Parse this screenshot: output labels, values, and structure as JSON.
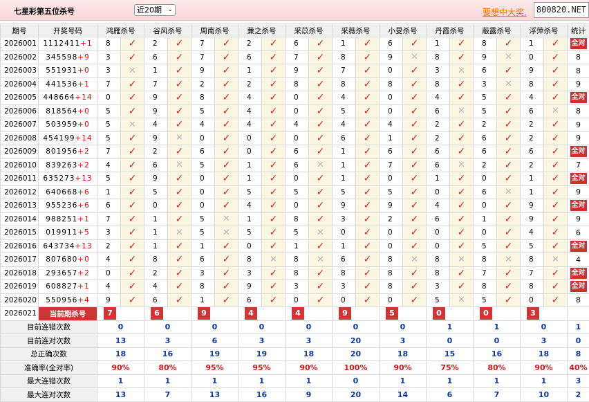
{
  "header": {
    "title": "七星彩第五位杀号",
    "period_select": "近20期",
    "slogan": "要想中大奖,",
    "logo": "800820.NET"
  },
  "columns": {
    "issue": "期号",
    "draw": "开奖号码",
    "experts": [
      "鸿雁杀号",
      "谷风杀号",
      "周南杀号",
      "蒹之杀号",
      "采苡杀号",
      "采薇杀号",
      "小旻杀号",
      "丹霞杀号",
      "蔽露杀号",
      "浮萍杀号"
    ],
    "stat": "统计"
  },
  "rows": [
    {
      "issue": "2026001",
      "nums": "1112411",
      "add": "+1",
      "kills": [
        8,
        2,
        7,
        2,
        6,
        1,
        6,
        1,
        8,
        1
      ],
      "hits": [
        1,
        1,
        1,
        1,
        1,
        1,
        1,
        1,
        1,
        1
      ],
      "stat": "全对"
    },
    {
      "issue": "2026002",
      "nums": "345598",
      "add": "+9",
      "kills": [
        3,
        6,
        7,
        6,
        7,
        8,
        9,
        8,
        9,
        0
      ],
      "hits": [
        1,
        1,
        1,
        1,
        1,
        1,
        0,
        1,
        0,
        1
      ],
      "stat": "8"
    },
    {
      "issue": "2026003",
      "nums": "551931",
      "add": "+0",
      "kills": [
        3,
        1,
        9,
        1,
        9,
        7,
        0,
        3,
        6,
        9
      ],
      "hits": [
        0,
        1,
        1,
        1,
        1,
        1,
        1,
        0,
        1,
        1
      ],
      "stat": "8"
    },
    {
      "issue": "2026004",
      "nums": "441536",
      "add": "+1",
      "kills": [
        7,
        7,
        2,
        2,
        8,
        8,
        8,
        8,
        3,
        8
      ],
      "hits": [
        1,
        1,
        1,
        1,
        1,
        1,
        1,
        1,
        0,
        1
      ],
      "stat": "9"
    },
    {
      "issue": "2026005",
      "nums": "448664",
      "add": "+14",
      "kills": [
        0,
        9,
        8,
        4,
        0,
        4,
        0,
        4,
        5,
        4
      ],
      "hits": [
        1,
        1,
        1,
        1,
        1,
        1,
        1,
        1,
        1,
        1
      ],
      "stat": "全对"
    },
    {
      "issue": "2026006",
      "nums": "818564",
      "add": "+0",
      "kills": [
        5,
        9,
        5,
        4,
        0,
        5,
        0,
        6,
        5,
        6
      ],
      "hits": [
        1,
        1,
        1,
        1,
        1,
        1,
        1,
        0,
        1,
        0
      ],
      "stat": "8"
    },
    {
      "issue": "2026007",
      "nums": "503959",
      "add": "+0",
      "kills": [
        5,
        4,
        4,
        4,
        4,
        4,
        4,
        2,
        2,
        2
      ],
      "hits": [
        0,
        1,
        1,
        1,
        1,
        1,
        1,
        1,
        1,
        1
      ],
      "stat": "9"
    },
    {
      "issue": "2026008",
      "nums": "454199",
      "add": "+14",
      "kills": [
        5,
        9,
        0,
        0,
        0,
        6,
        1,
        2,
        6,
        2
      ],
      "hits": [
        1,
        0,
        1,
        1,
        1,
        1,
        1,
        1,
        1,
        1
      ],
      "stat": "9"
    },
    {
      "issue": "2026009",
      "nums": "801956",
      "add": "+2",
      "kills": [
        7,
        2,
        6,
        0,
        6,
        1,
        6,
        6,
        6,
        6
      ],
      "hits": [
        1,
        1,
        1,
        1,
        1,
        1,
        1,
        1,
        1,
        1
      ],
      "stat": "全对"
    },
    {
      "issue": "2026010",
      "nums": "839263",
      "add": "+2",
      "kills": [
        4,
        6,
        5,
        1,
        6,
        1,
        7,
        6,
        2,
        2
      ],
      "hits": [
        1,
        0,
        1,
        1,
        0,
        1,
        1,
        0,
        1,
        1
      ],
      "stat": "7"
    },
    {
      "issue": "2026011",
      "nums": "635273",
      "add": "+13",
      "kills": [
        5,
        9,
        0,
        1,
        0,
        1,
        0,
        1,
        0,
        1
      ],
      "hits": [
        1,
        1,
        1,
        1,
        1,
        1,
        1,
        1,
        1,
        1
      ],
      "stat": "全对"
    },
    {
      "issue": "2026012",
      "nums": "640668",
      "add": "+6",
      "kills": [
        1,
        5,
        0,
        5,
        5,
        5,
        5,
        0,
        6,
        1
      ],
      "hits": [
        1,
        1,
        1,
        1,
        1,
        1,
        1,
        1,
        0,
        1
      ],
      "stat": "9"
    },
    {
      "issue": "2026013",
      "nums": "955236",
      "add": "+6",
      "kills": [
        6,
        0,
        0,
        4,
        0,
        9,
        9,
        4,
        0,
        9
      ],
      "hits": [
        1,
        1,
        1,
        1,
        1,
        1,
        1,
        1,
        1,
        1
      ],
      "stat": "全对"
    },
    {
      "issue": "2026014",
      "nums": "988251",
      "add": "+1",
      "kills": [
        7,
        1,
        5,
        1,
        8,
        3,
        2,
        6,
        1,
        9
      ],
      "hits": [
        1,
        1,
        0,
        1,
        1,
        1,
        1,
        1,
        1,
        1
      ],
      "stat": "9"
    },
    {
      "issue": "2026015",
      "nums": "019911",
      "add": "+5",
      "kills": [
        3,
        1,
        5,
        5,
        5,
        0,
        0,
        0,
        0,
        4
      ],
      "hits": [
        1,
        0,
        0,
        1,
        0,
        1,
        1,
        1,
        1,
        1
      ],
      "stat": "6"
    },
    {
      "issue": "2026016",
      "nums": "643734",
      "add": "+13",
      "kills": [
        2,
        1,
        1,
        0,
        1,
        1,
        0,
        0,
        5,
        5
      ],
      "hits": [
        1,
        1,
        1,
        1,
        1,
        1,
        1,
        1,
        1,
        1
      ],
      "stat": "全对"
    },
    {
      "issue": "2026017",
      "nums": "807680",
      "add": "+0",
      "kills": [
        4,
        8,
        6,
        8,
        8,
        6,
        8,
        8,
        8,
        8
      ],
      "hits": [
        1,
        1,
        1,
        0,
        0,
        1,
        0,
        0,
        0,
        0
      ],
      "stat": "4"
    },
    {
      "issue": "2026018",
      "nums": "293657",
      "add": "+2",
      "kills": [
        0,
        2,
        3,
        3,
        8,
        8,
        8,
        8,
        7,
        7
      ],
      "hits": [
        1,
        1,
        1,
        1,
        1,
        1,
        1,
        1,
        1,
        1
      ],
      "stat": "全对"
    },
    {
      "issue": "2026019",
      "nums": "608827",
      "add": "+1",
      "kills": [
        4,
        4,
        8,
        9,
        3,
        3,
        8,
        3,
        8,
        8
      ],
      "hits": [
        1,
        1,
        1,
        1,
        1,
        1,
        1,
        1,
        1,
        1
      ],
      "stat": "全对"
    },
    {
      "issue": "2026020",
      "nums": "550956",
      "add": "+4",
      "kills": [
        9,
        6,
        1,
        6,
        0,
        0,
        0,
        5,
        5,
        0
      ],
      "hits": [
        1,
        1,
        1,
        1,
        1,
        1,
        1,
        0,
        1,
        1
      ],
      "stat": "8"
    }
  ],
  "current": {
    "issue": "2026021",
    "label": "当前期杀号",
    "kills": [
      7,
      6,
      9,
      4,
      4,
      9,
      5,
      0,
      0,
      3
    ]
  },
  "summary": [
    {
      "label": "目前连错次数",
      "values": [
        "0",
        "0",
        "0",
        "0",
        "0",
        "0",
        "0",
        "1",
        "1",
        "0",
        "1"
      ]
    },
    {
      "label": "目前连对次数",
      "values": [
        "13",
        "3",
        "6",
        "3",
        "3",
        "20",
        "3",
        "0",
        "0",
        "3",
        "0"
      ]
    },
    {
      "label": "总正确次数",
      "values": [
        "18",
        "16",
        "19",
        "19",
        "18",
        "20",
        "18",
        "15",
        "16",
        "18",
        "8"
      ]
    },
    {
      "label": "准确率(全对率)",
      "values": [
        "90%",
        "80%",
        "95%",
        "95%",
        "90%",
        "100%",
        "90%",
        "75%",
        "80%",
        "90%",
        "40%"
      ]
    },
    {
      "label": "最大连错次数",
      "values": [
        "1",
        "1",
        "1",
        "1",
        "1",
        "0",
        "1",
        "1",
        "1",
        "1",
        "3"
      ]
    },
    {
      "label": "最大连对次数",
      "values": [
        "13",
        "7",
        "13",
        "16",
        "9",
        "20",
        "14",
        "6",
        "7",
        "10",
        "2"
      ]
    }
  ],
  "marks": {
    "hit": "✓",
    "miss": "✕"
  },
  "colors": {
    "accent": "#d03535",
    "summary_blue": "#0b37a5",
    "cell_bg": "#fcf7e2"
  }
}
